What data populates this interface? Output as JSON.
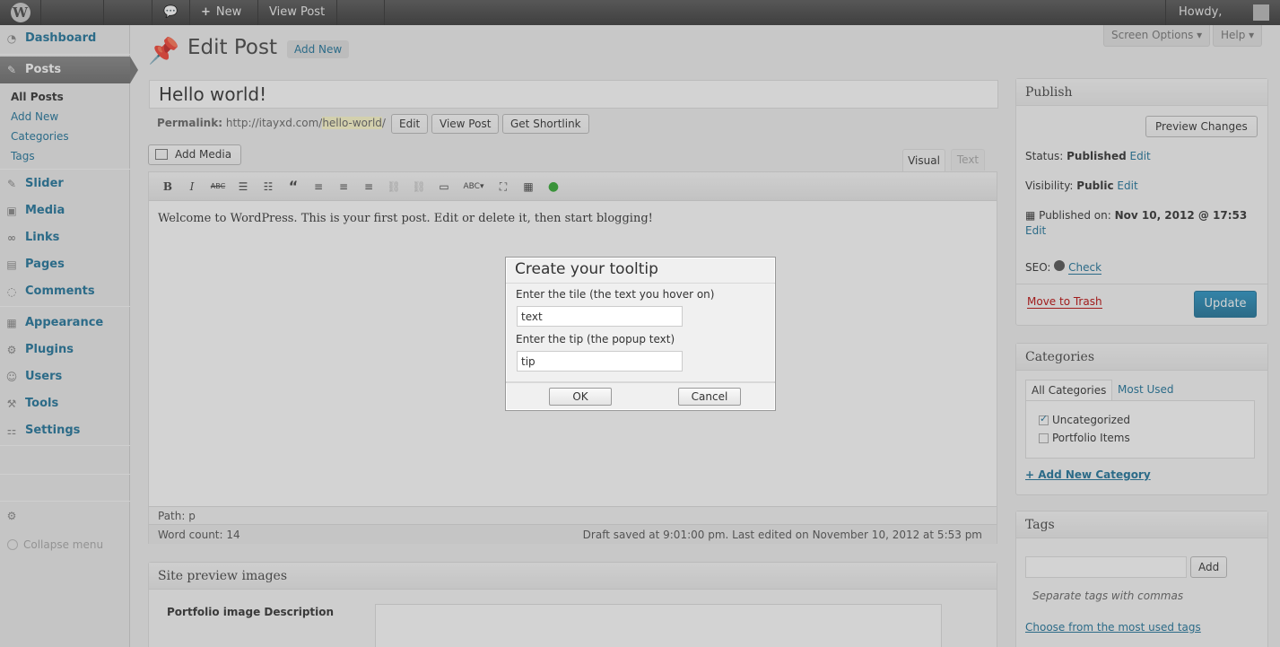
{
  "adminbar": {
    "new_label": "New",
    "view_post_label": "View Post",
    "howdy": "Howdy,"
  },
  "sidebar": {
    "dashboard": "Dashboard",
    "posts": "Posts",
    "posts_sub": [
      "All Posts",
      "Add New",
      "Categories",
      "Tags"
    ],
    "slider": "Slider",
    "media": "Media",
    "links": "Links",
    "pages": "Pages",
    "comments": "Comments",
    "appearance": "Appearance",
    "plugins": "Plugins",
    "users": "Users",
    "tools": "Tools",
    "settings": "Settings",
    "collapse": "Collapse menu"
  },
  "header": {
    "title": "Edit Post",
    "add_new": "Add New",
    "screen_options": "Screen Options ▾",
    "help": "Help ▾"
  },
  "post": {
    "title": "Hello world!",
    "permalink_label": "Permalink:",
    "permalink_base": "http://itayxd.com/",
    "permalink_slug": "hello-world",
    "permalink_end": "/",
    "edit_btn": "Edit",
    "view_post_btn": "View Post",
    "shortlink_btn": "Get Shortlink",
    "add_media": "Add Media",
    "tab_visual": "Visual",
    "tab_text": "Text",
    "content": "Welcome to WordPress. This is your first post. Edit or delete it, then start blogging!",
    "path": "Path: p",
    "word_count": "Word count: 14",
    "draft_saved": "Draft saved at 9:01:00 pm. Last edited on November 10, 2012 at 5:53 pm"
  },
  "site_preview": {
    "title": "Site preview images",
    "desc_label": "Portfolio image Description"
  },
  "publish": {
    "title": "Publish",
    "preview_btn": "Preview Changes",
    "status_label": "Status:",
    "status_value": "Published",
    "visibility_label": "Visibility:",
    "visibility_value": "Public",
    "published_label": "Published on:",
    "published_value": "Nov 10, 2012 @ 17:53",
    "edit": "Edit",
    "seo_label": "SEO:",
    "seo_check": "Check",
    "trash": "Move to Trash",
    "update": "Update"
  },
  "categories": {
    "title": "Categories",
    "tab_all": "All Categories",
    "tab_most": "Most Used",
    "items": [
      {
        "label": "Uncategorized",
        "checked": true
      },
      {
        "label": "Portfolio Items",
        "checked": false
      }
    ],
    "add_new": "+ Add New Category"
  },
  "tags": {
    "title": "Tags",
    "add_btn": "Add",
    "hint": "Separate tags with commas",
    "choose": "Choose from the most used tags"
  },
  "dialog": {
    "title": "Create your tooltip",
    "label_title": "Enter the tile (the text you hover on)",
    "value_title": "text",
    "label_tip": "Enter the tip (the popup text)",
    "value_tip": "tip",
    "ok": "OK",
    "cancel": "Cancel"
  }
}
